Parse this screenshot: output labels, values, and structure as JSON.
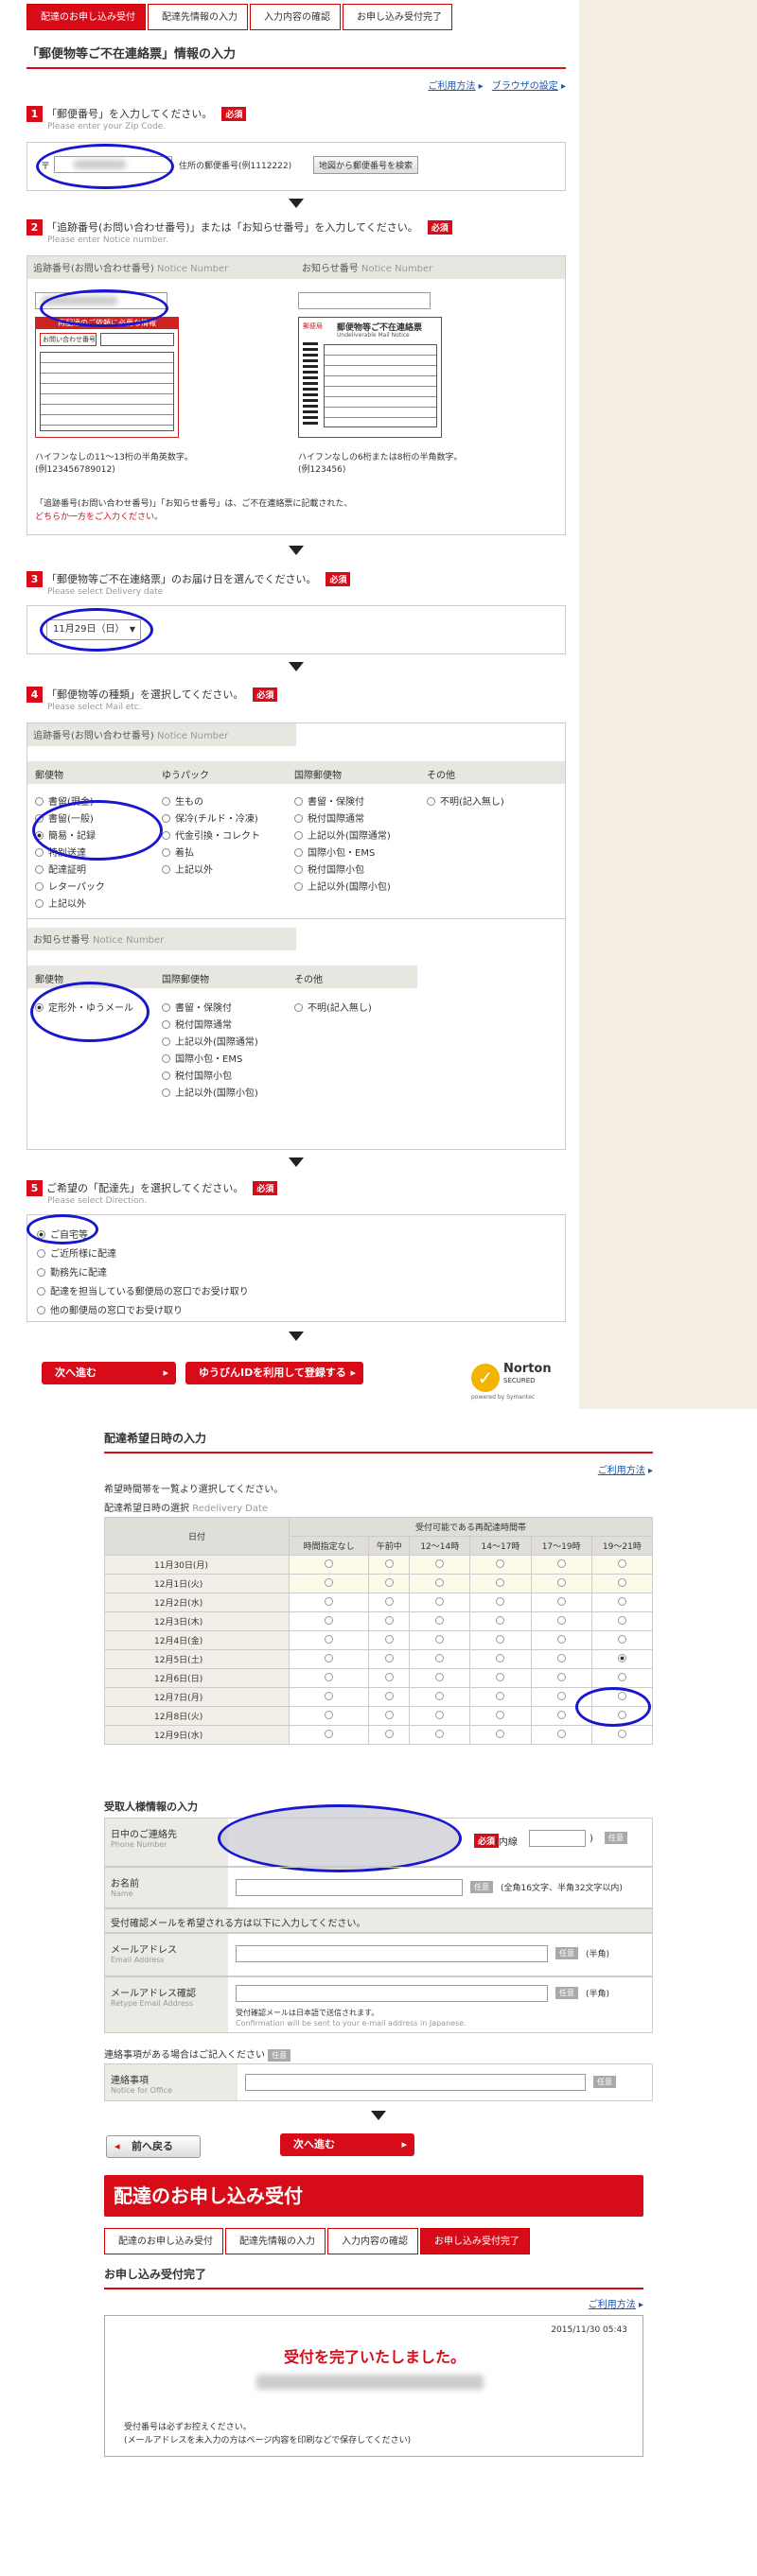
{
  "steps": [
    "配達のお申し込み受付",
    "配達先情報の入力",
    "入力内容の確認",
    "お申し込み受付完了"
  ],
  "page_title": "「郵便物等ご不在連絡票」情報の入力",
  "links": {
    "help": "ご利用方法",
    "browser": "ブラウザの設定"
  },
  "required": "必須",
  "s1": {
    "num": "1",
    "title": "「郵便番号」を入力してください。",
    "sub": "Please enter your Zip Code.",
    "zip_mark": "〒",
    "hint": "住所の郵便番号(例1112222)",
    "btn": "地図から郵便番号を検索"
  },
  "s2": {
    "num": "2",
    "title": "「追跡番号(お問い合わせ番号)」または「お知らせ番号」を入力してください。",
    "sub": "Please enter Notice number.",
    "left_h": "追跡番号(お問い合わせ番号)",
    "left_h_en": "Notice Number",
    "right_h": "お知らせ番号",
    "right_h_en": "Notice Number",
    "left_img_title": "再配達のご依頼に必要な情報",
    "left_img_label": "お問い合わせ番号",
    "right_img_brand": "郵便局",
    "right_img_title": "郵便物等ご不在連絡票",
    "right_img_en": "Undeliverable Mail Notice",
    "left_note": "ハイフンなしの11〜13桁の半角英数字。",
    "left_ex": "(例123456789012)",
    "right_note": "ハイフンなしの6桁または8桁の半角数字。",
    "right_ex": "(例123456)",
    "foot1": "「追跡番号(お問い合わせ番号)」「お知らせ番号」は、ご不在連絡票に記載された、",
    "foot2": "どちらか一方をご入力ください。"
  },
  "s3": {
    "num": "3",
    "title": "「郵便物等ご不在連絡票」のお届け日を選んでください。",
    "sub": "Please select Delivery date",
    "select": "11月29日（日）"
  },
  "s4": {
    "num": "4",
    "title": "「郵便物等の種類」を選択してください。",
    "sub": "Please select Mail etc.",
    "hdr": "追跡番号(お問い合わせ番号)",
    "hdr_en": "Notice Number",
    "cols": [
      "郵便物",
      "ゆうパック",
      "国際郵便物",
      "その他"
    ],
    "c1": [
      "書留(現金)",
      "書留(一般)",
      "簡易・記録",
      "特別送達",
      "配達証明",
      "レターパック",
      "上記以外"
    ],
    "c2": [
      "生もの",
      "保冷(チルド・冷凍)",
      "代金引換・コレクト",
      "着払",
      "上記以外"
    ],
    "c3": [
      "書留・保険付",
      "税付国際通常",
      "上記以外(国際通常)",
      "国際小包・EMS",
      "税付国際小包",
      "上記以外(国際小包)"
    ],
    "c4": [
      "不明(記入無し)"
    ],
    "hdr2": "お知らせ番号",
    "hdr2_en": "Notice Number",
    "cols2": [
      "郵便物",
      "国際郵便物",
      "その他"
    ],
    "d1": [
      "定形外・ゆうメール"
    ],
    "d2": [
      "書留・保険付",
      "税付国際通常",
      "上記以外(国際通常)",
      "国際小包・EMS",
      "税付国際小包",
      "上記以外(国際小包)"
    ],
    "d3": [
      "不明(記入無し)"
    ]
  },
  "s5": {
    "num": "5",
    "title": "ご希望の「配達先」を選択してください。",
    "sub": "Please select Direction.",
    "opts": [
      "ご自宅等",
      "ご近所様に配達",
      "勤務先に配達",
      "配達を担当している郵便局の窓口でお受け取り",
      "他の郵便局の窓口でお受け取り"
    ]
  },
  "buttons": {
    "next": "次へ進む",
    "yuubin_id": "ゆうびんIDを利用して登録する",
    "back": "前へ戻る"
  },
  "norton": {
    "brand": "Norton",
    "secured": "SECURED",
    "by": "powered by Symantec"
  },
  "delivery": {
    "title": "配達希望日時の入力",
    "help": "ご利用方法",
    "note": "希望時間帯を一覧より選択してください。",
    "select_label": "配達希望日時の選択",
    "select_label_en": "Redelivery Date",
    "col_date": "日付",
    "col_group": "受付可能である再配達時間帯",
    "times": [
      "時間指定なし",
      "午前中",
      "12〜14時",
      "14〜17時",
      "17〜19時",
      "19〜21時"
    ],
    "dates": [
      "11月30日(月)",
      "12月1日(火)",
      "12月2日(水)",
      "12月3日(木)",
      "12月4日(金)",
      "12月5日(土)",
      "12月6日(日)",
      "12月7日(月)",
      "12月8日(火)",
      "12月9日(水)"
    ]
  },
  "recipient": {
    "title": "受取人様情報の入力",
    "phone": "日中のご連絡先",
    "phone_en": "Phone Number",
    "ext": "(内線",
    "ext_close": ")",
    "optional": "任意",
    "name": "お名前",
    "name_en": "Name",
    "name_hint": "(全角16文字、半角32文字以内)",
    "mail_note": "受付確認メールを希望される方は以下に入力してください。",
    "email": "メールアドレス",
    "email_en": "Email Address",
    "halfwidth": "(半角)",
    "email2": "メールアドレス確認",
    "email2_en": "Retype Email Address",
    "mail_j": "受付確認メールは日本語で送信されます。",
    "mail_e": "Confirmation will be sent to your e-mail address in Japanese."
  },
  "notice": {
    "label": "連絡事項がある場合はご記入ください",
    "field": "連絡事項",
    "field_en": "Notice for Office"
  },
  "complete": {
    "banner": "配達のお申し込み受付",
    "title": "お申し込み受付完了",
    "help": "ご利用方法",
    "datetime": "2015/11/30 05:43",
    "msg": "受付を完了いたしました。",
    "note1": "受付番号は必ずお控えください。",
    "note2": "(メールアドレスを未入力の方はページ内容を印刷などで保存してください)"
  }
}
